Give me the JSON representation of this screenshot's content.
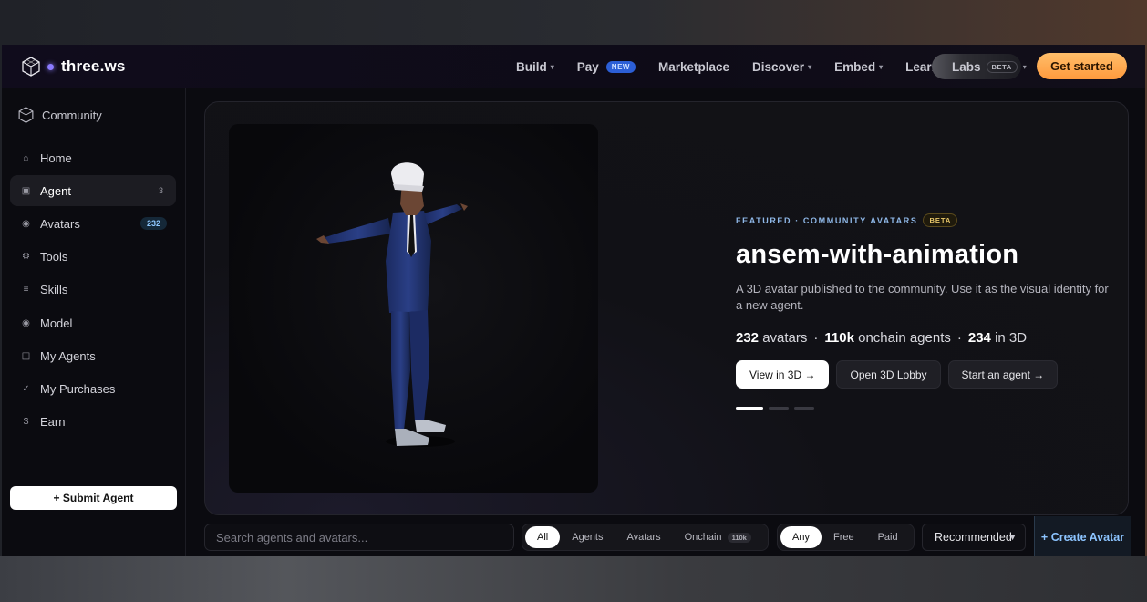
{
  "brand": {
    "name": "three.ws"
  },
  "nav": {
    "build": "Build",
    "pay": "Pay",
    "pay_badge": "NEW",
    "marketplace": "Marketplace",
    "discover": "Discover",
    "embed": "Embed",
    "learn": "Learn",
    "labs": "Labs",
    "labs_badge": "BETA",
    "get_started": "Get started"
  },
  "sidebar": {
    "section": "Community",
    "items": [
      {
        "label": "Home",
        "icon": "home-icon"
      },
      {
        "label": "Agent",
        "icon": "agent-icon",
        "count": "3"
      },
      {
        "label": "Avatars",
        "icon": "avatar-icon",
        "count": "232"
      },
      {
        "label": "Tools",
        "icon": "gear-icon"
      },
      {
        "label": "Skills",
        "icon": "list-icon"
      },
      {
        "label": "Model",
        "icon": "model-icon"
      },
      {
        "label": "My Agents",
        "icon": "grid-icon"
      },
      {
        "label": "My Purchases",
        "icon": "check-icon"
      },
      {
        "label": "Earn",
        "icon": "dollar-icon"
      }
    ],
    "submit": "+ Submit Agent"
  },
  "hero": {
    "eyebrow": "FEATURED · COMMUNITY AVATARS",
    "badge": "BETA",
    "title": "ansem-with-animation",
    "description": "A 3D avatar published to the community. Use it as the visual identity for a new agent.",
    "stats": {
      "avatars_num": "232",
      "avatars_label": "avatars",
      "agents_num": "110k",
      "agents_label": "onchain agents",
      "threed_num": "234",
      "threed_label": "in 3D",
      "sep": "·"
    },
    "buttons": {
      "view": "View in 3D →",
      "lobby": "Open 3D Lobby",
      "start": "Start an agent →"
    },
    "carousel": {
      "total": 3,
      "active": 1
    }
  },
  "filters": {
    "search_placeholder": "Search agents and avatars...",
    "type": [
      "All",
      "Agents",
      "Avatars",
      "Onchain"
    ],
    "onchain_count": "110k",
    "price": [
      "Any",
      "Free",
      "Paid"
    ],
    "sort": "Recommended",
    "create": "+ Create Avatar"
  }
}
